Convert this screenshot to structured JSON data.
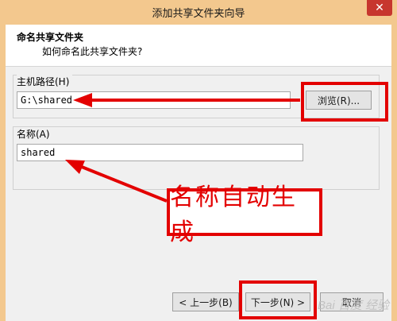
{
  "window": {
    "title": "添加共享文件夹向导",
    "close_symbol": "✕"
  },
  "header": {
    "title": "命名共享文件夹",
    "subtitle": "如何命名此共享文件夹?"
  },
  "host_path": {
    "label": "主机路径(H)",
    "value": "G:\\shared",
    "browse_label": "浏览(R)..."
  },
  "name": {
    "label": "名称(A)",
    "value": "shared"
  },
  "callout": {
    "text": "名称自动生成"
  },
  "footer": {
    "back_label": "< 上一步(B)",
    "next_label": "下一步(N) >",
    "cancel_label": "取消"
  },
  "watermark": {
    "text": "Bai 百度 经验"
  },
  "colors": {
    "titlebar": "#f3c88e",
    "annotation_red": "#e30000",
    "dialog_bg": "#f0f0f0"
  },
  "icons": {
    "close": "close-icon",
    "arrow": "red-arrow-icon"
  }
}
